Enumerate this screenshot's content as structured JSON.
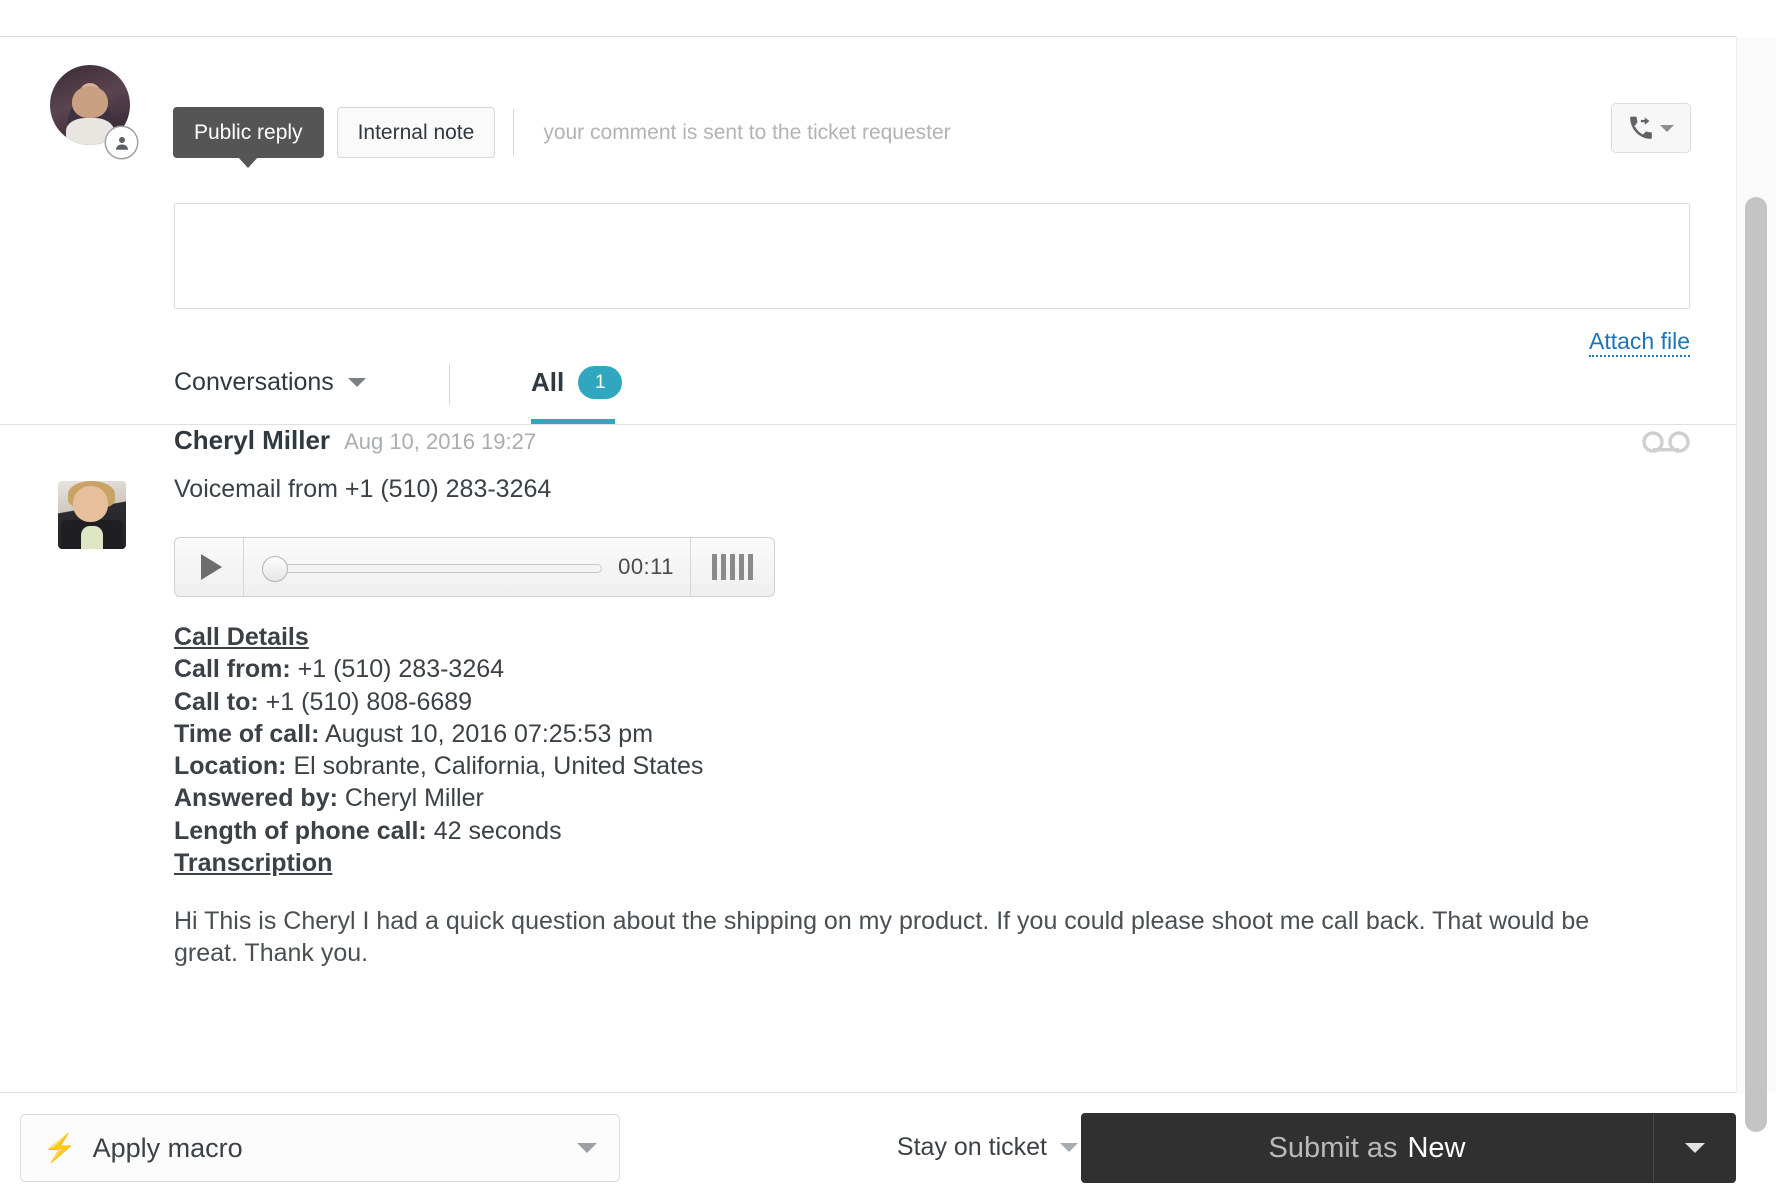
{
  "composer": {
    "public_reply_label": "Public reply",
    "internal_note_label": "Internal note",
    "hint": "your comment is sent to the ticket requester",
    "reply_value": "",
    "reply_placeholder": "",
    "attach_label": "Attach file",
    "call_forward_icon": "phone-forward-icon",
    "avatar_icon": "agent-avatar"
  },
  "tabs": {
    "conversations_label": "Conversations",
    "all_label": "All",
    "all_count": "1",
    "accent_color": "#30a7bf"
  },
  "comment": {
    "author": "Cheryl Miller",
    "timestamp": "Aug 10, 2016 19:27",
    "subject": "Voicemail from +1 (510) 283-3264",
    "channel_icon": "voicemail-icon",
    "player": {
      "play_icon": "play-icon",
      "duration": "00:11",
      "volume_icon": "volume-bars-icon",
      "progress_percent": 0
    },
    "details_title": "Call Details",
    "details": [
      {
        "label": "Call from:",
        "value": "+1 (510) 283-3264"
      },
      {
        "label": "Call to:",
        "value": "+1 (510) 808-6689"
      },
      {
        "label": "Time of call:",
        "value": "August 10, 2016 07:25:53 pm"
      },
      {
        "label": "Location:",
        "value": "El sobrante, California, United States"
      },
      {
        "label": "Answered by:",
        "value": "Cheryl Miller"
      },
      {
        "label": "Length of phone call:",
        "value": "42 seconds"
      }
    ],
    "transcription_title": "Transcription",
    "transcription": "Hi This is Cheryl I had a quick question about the shipping on my product. If you could please shoot me call back. That would be great. Thank you."
  },
  "footer": {
    "macro_label": "Apply macro",
    "macro_icon": "lightning-bolt-icon",
    "stay_label": "Stay on ticket",
    "submit_prefix": "Submit as",
    "submit_status": "New",
    "submit_bg": "#303030"
  }
}
